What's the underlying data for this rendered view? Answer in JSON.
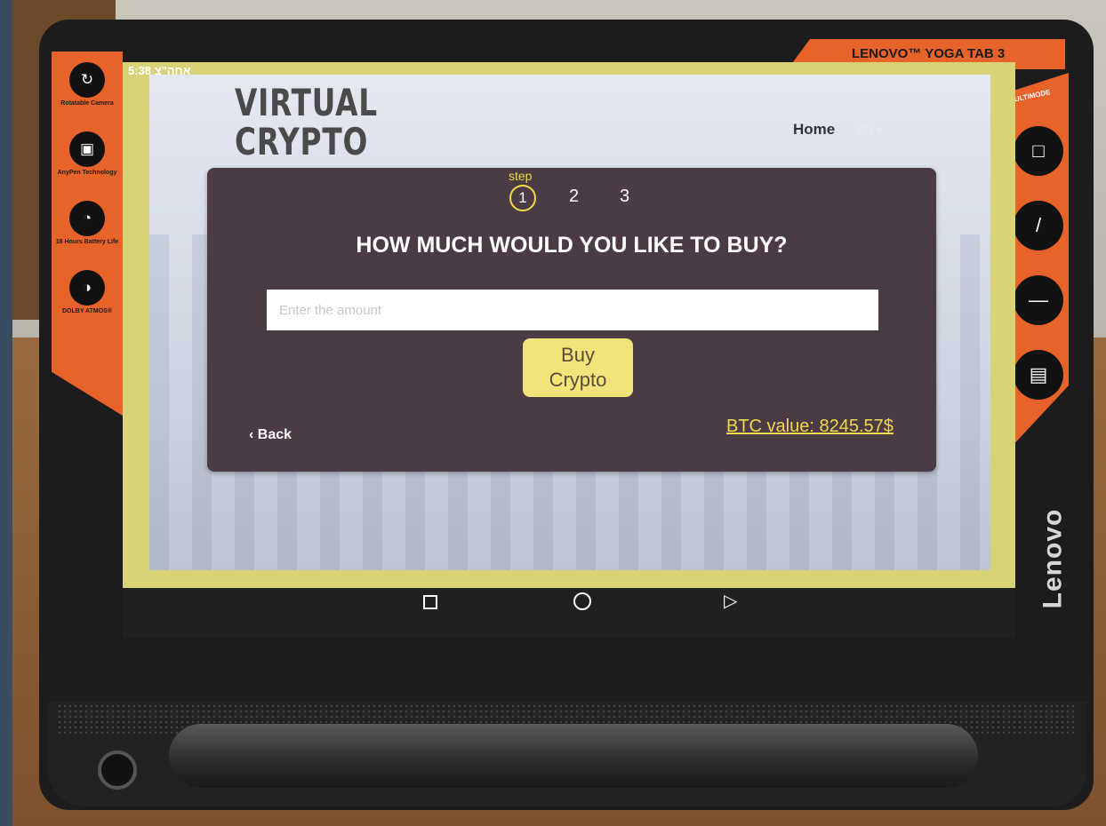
{
  "device": {
    "model_banner": "LENOVO™ YOGA TAB 3",
    "brand": "Lenovo",
    "multimode_label": "MULTIMODE",
    "features": [
      {
        "icon": "rotate-camera-icon",
        "label": "Rotatable Camera"
      },
      {
        "icon": "anypen-icon",
        "label": "AnyPen Technology"
      },
      {
        "icon": "battery-clock-icon",
        "label": "18 Hours Battery Life"
      },
      {
        "icon": "dolby-icon",
        "label": "DOLBY ATMOS®"
      }
    ],
    "modes": [
      "tablet-mode-icon",
      "stand-mode-icon",
      "tilt-mode-icon",
      "hang-mode-icon"
    ]
  },
  "status_bar": {
    "text": "אחה\"צ 5:38"
  },
  "site": {
    "logo_line1": "VIRTUAL",
    "logo_line2": "CRYPTO",
    "nav_home": "Home",
    "nav_lang": "EN ▾"
  },
  "wizard": {
    "step_label": "step",
    "steps": [
      "1",
      "2",
      "3"
    ],
    "question": "HOW MUCH WOULD YOU LIKE TO BUY?",
    "amount_placeholder": "Enter the amount",
    "buy_line1": "Buy",
    "buy_line2": "Crypto",
    "back_label": "‹ Back",
    "btc_value": "BTC value: 8245.57$"
  },
  "colors": {
    "accent": "#f0d94a",
    "panel": "#4b3b45",
    "device_orange": "#e8632a"
  }
}
